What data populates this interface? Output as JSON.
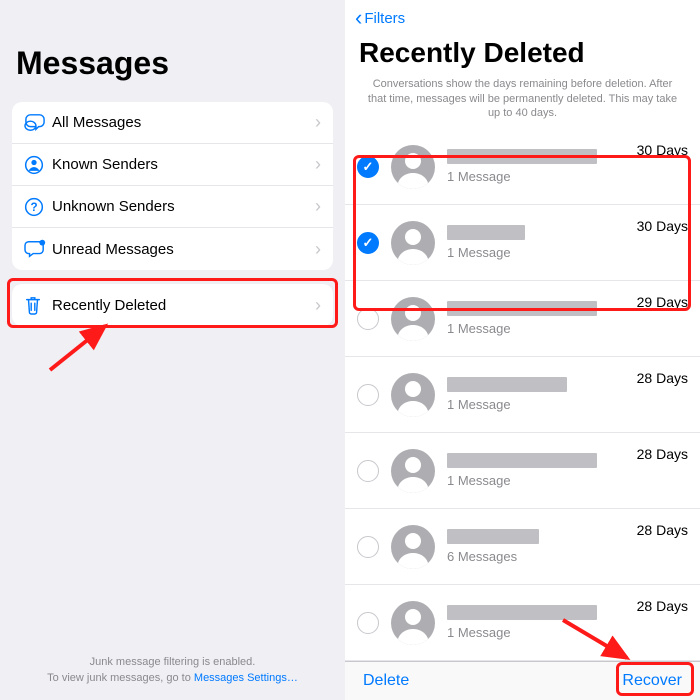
{
  "left": {
    "title": "Messages",
    "filters": [
      {
        "label": "All Messages"
      },
      {
        "label": "Known Senders"
      },
      {
        "label": "Unknown Senders"
      },
      {
        "label": "Unread Messages"
      }
    ],
    "recently_deleted_label": "Recently Deleted",
    "footer_line1": "Junk message filtering is enabled.",
    "footer_line2_a": "To view junk messages, go to ",
    "footer_link": "Messages Settings…"
  },
  "right": {
    "back_label": "Filters",
    "title": "Recently Deleted",
    "help": "Conversations show the days remaining before deletion. After that time, messages will be permanently deleted. This may take up to 40 days.",
    "conversations": [
      {
        "selected": true,
        "sub": "1 Message",
        "days": "30 Days",
        "name_w": 150
      },
      {
        "selected": true,
        "sub": "1 Message",
        "days": "30 Days",
        "name_w": 78
      },
      {
        "selected": false,
        "sub": "1 Message",
        "days": "29 Days",
        "name_w": 150
      },
      {
        "selected": false,
        "sub": "1 Message",
        "days": "28 Days",
        "name_w": 120
      },
      {
        "selected": false,
        "sub": "1 Message",
        "days": "28 Days",
        "name_w": 150
      },
      {
        "selected": false,
        "sub": "6 Messages",
        "days": "28 Days",
        "name_w": 92
      },
      {
        "selected": false,
        "sub": "1 Message",
        "days": "28 Days",
        "name_w": 150
      }
    ],
    "delete_label": "Delete",
    "recover_label": "Recover"
  }
}
